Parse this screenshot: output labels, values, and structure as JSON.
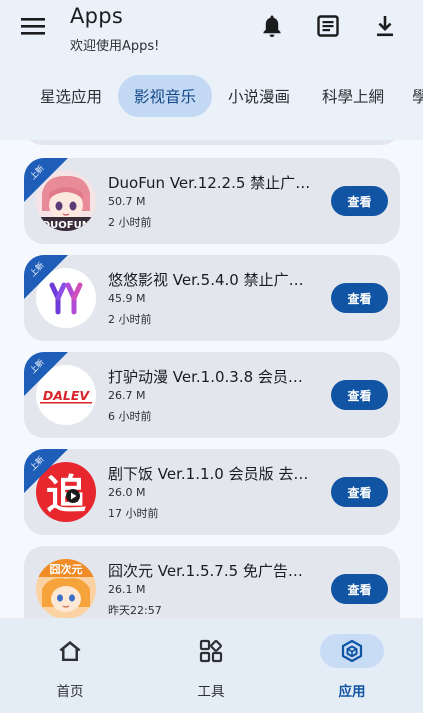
{
  "header": {
    "title": "Apps",
    "subtitle": "欢迎使用Apps!",
    "icons": [
      "menu-icon",
      "bell-icon",
      "list-icon",
      "download-icon"
    ]
  },
  "tabs": [
    {
      "label": "星选应用",
      "active": false
    },
    {
      "label": "影视音乐",
      "active": true
    },
    {
      "label": "小说漫画",
      "active": false
    },
    {
      "label": "科學上網",
      "active": false
    },
    {
      "label": "學",
      "active": false
    }
  ],
  "apps": [
    {
      "name": "DuoFun Ver.12.2.5 禁止广告…",
      "size": "50.7 M",
      "time": "2 小时前",
      "badge": "上新",
      "button": "查看",
      "icon_text": "DUOFUN"
    },
    {
      "name": "悠悠影视 Ver.5.4.0 禁止广告…",
      "size": "45.9 M",
      "time": "2 小时前",
      "badge": "上新",
      "button": "查看",
      "icon_text": "yy"
    },
    {
      "name": "打驴动漫 Ver.1.0.3.8 会员…",
      "size": "26.7 M",
      "time": "6 小时前",
      "badge": "上新",
      "button": "查看",
      "icon_text": "DALEV"
    },
    {
      "name": "剧下饭 Ver.1.1.0 会员版 去…",
      "size": "26.0 M",
      "time": "17 小时前",
      "badge": "上新",
      "button": "查看",
      "icon_text": "追"
    },
    {
      "name": "囧次元 Ver.1.5.7.5 免广告…",
      "size": "26.1 M",
      "time": "昨天22:57",
      "badge": "",
      "button": "查看",
      "icon_text": "囧次元"
    }
  ],
  "bottom_nav": [
    {
      "label": "首页",
      "icon": "home-icon",
      "active": false
    },
    {
      "label": "工具",
      "icon": "tools-grid-icon",
      "active": false
    },
    {
      "label": "应用",
      "icon": "apps-cube-icon",
      "active": true
    }
  ],
  "colors": {
    "accent": "#1154a3",
    "ribbon": "#1f5eb8",
    "card": "#e3e6ec",
    "active_tab": "#c3d8f3"
  }
}
